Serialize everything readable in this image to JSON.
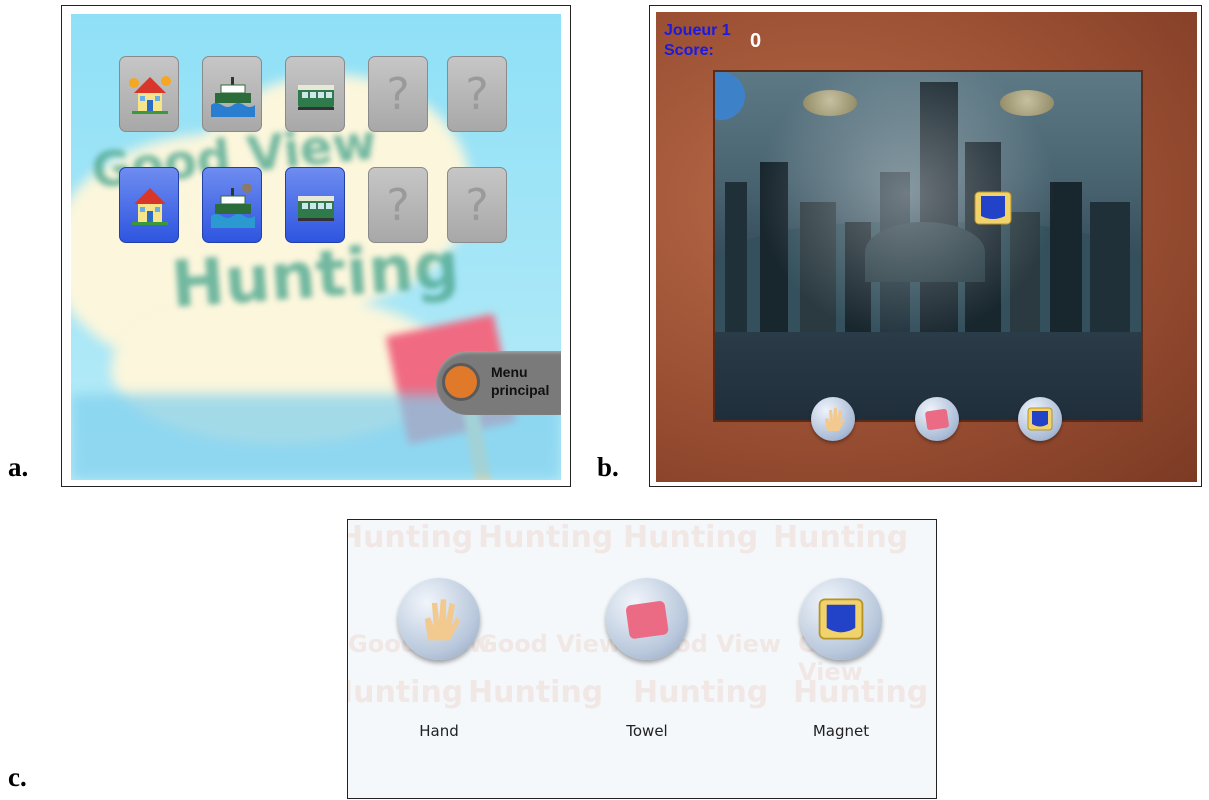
{
  "labels": {
    "a": "a.",
    "b": "b.",
    "c": "c."
  },
  "panel_a": {
    "cards_top": [
      "house-icon",
      "ferry-icon",
      "tram-icon",
      "?",
      "?"
    ],
    "cards_bottom": [
      "house-icon",
      "ferry-icon",
      "tram-icon",
      "?",
      "?"
    ],
    "menu_line1": "Menu",
    "menu_line2": "principal"
  },
  "panel_b": {
    "player": "Joueur 1",
    "score_label": "Score:",
    "score_value": "0",
    "tools": [
      "hand-icon",
      "towel-icon",
      "magnet-icon"
    ]
  },
  "panel_c": {
    "tools": [
      {
        "icon": "hand-icon",
        "label": "Hand"
      },
      {
        "icon": "towel-icon",
        "label": "Towel"
      },
      {
        "icon": "magnet-icon",
        "label": "Magnet"
      }
    ]
  },
  "colors": {
    "card_blue": "#2e55e0",
    "card_grey": "#a8a8a8",
    "hud_blue": "#1a1ae0",
    "wood": "#9a4f33"
  }
}
